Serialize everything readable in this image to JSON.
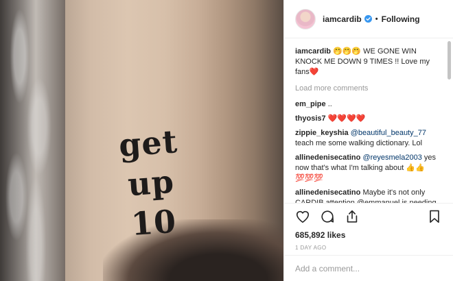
{
  "photo": {
    "tattoo_lines": [
      "get",
      "up",
      "10"
    ]
  },
  "header": {
    "username": "iamcardib",
    "separator": "•",
    "follow_status": "Following"
  },
  "caption": {
    "username": "iamcardib",
    "text": "🤭🤭🤭 WE GONE WIN KNOCK ME DOWN 9 TIMES !! Love my fans❤️"
  },
  "load_more": "Load more comments",
  "comments": [
    {
      "user": "em_pipe",
      "text": "..",
      "mention": ""
    },
    {
      "user": "thyosis7",
      "text": "❤️❤️❤️❤️",
      "mention": ""
    },
    {
      "user": "zippie_keyshia",
      "mention": "@beautiful_beauty_77",
      "text": "teach me some walking dictionary. Lol"
    },
    {
      "user": "allinedenisecatino",
      "mention": "@reyesmela2003",
      "text": "yes now that's what I'm talking about 👍👍 💯💯💯"
    },
    {
      "user": "allinedenisecatino",
      "mention": "",
      "text": "Maybe it's not only CARDIB attention @emmanuel is needing and wanting but everyone else's so he or she can feel validated and important"
    }
  ],
  "likes": "685,892 likes",
  "timestamp": "1 DAY AGO",
  "add_comment": {
    "placeholder": "Add a comment..."
  },
  "icons": {
    "like": "heart-icon",
    "comment": "comment-icon",
    "share": "share-icon",
    "save": "bookmark-icon",
    "verified": "verified-badge-icon"
  },
  "colors": {
    "link": "#003569",
    "muted": "#999999",
    "verified": "#3897f0",
    "text": "#262626"
  }
}
